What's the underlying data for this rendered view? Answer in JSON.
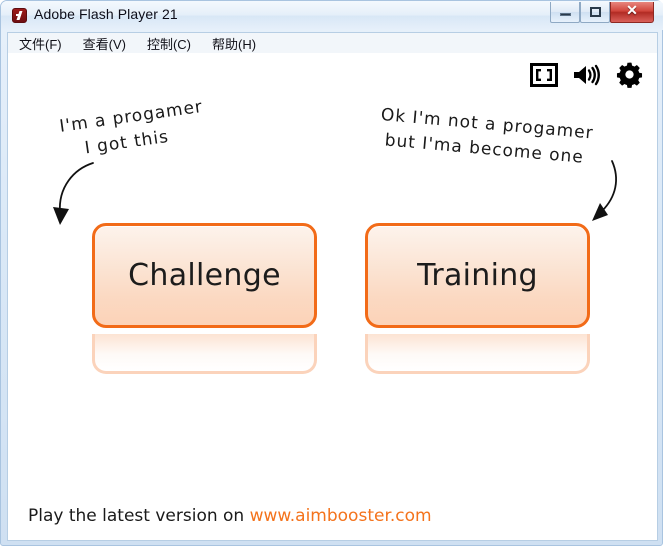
{
  "window": {
    "title": "Adobe Flash Player 21",
    "app_icon": "flash-icon",
    "controls": {
      "minimize_label": "–",
      "maximize_label": "□",
      "close_label": "✕"
    }
  },
  "menu": {
    "items": [
      {
        "label": "文件(F)",
        "name": "menu-file"
      },
      {
        "label": "查看(V)",
        "name": "menu-view"
      },
      {
        "label": "控制(C)",
        "name": "menu-control"
      },
      {
        "label": "帮助(H)",
        "name": "menu-help"
      }
    ]
  },
  "stage": {
    "icons": [
      {
        "name": "fullscreen-icon",
        "label": "Fullscreen"
      },
      {
        "name": "volume-icon",
        "label": "Volume"
      },
      {
        "name": "gear-icon",
        "label": "Settings"
      }
    ],
    "notes": {
      "left": {
        "line1": "I'm a progamer",
        "line2": "I got this"
      },
      "right": {
        "line1": "Ok I'm not a progamer",
        "line2": "but I'ma become one"
      }
    },
    "buttons": [
      {
        "name": "challenge-button",
        "label": "Challenge"
      },
      {
        "name": "training-button",
        "label": "Training"
      }
    ],
    "footer": {
      "text": "Play the latest version on",
      "url": "www.aimbooster.com"
    }
  },
  "colors": {
    "button_border": "#f26b18",
    "url_orange": "#f4731c",
    "close_red": "#c2332b",
    "titlebar_blue": "#dbe9f7"
  }
}
